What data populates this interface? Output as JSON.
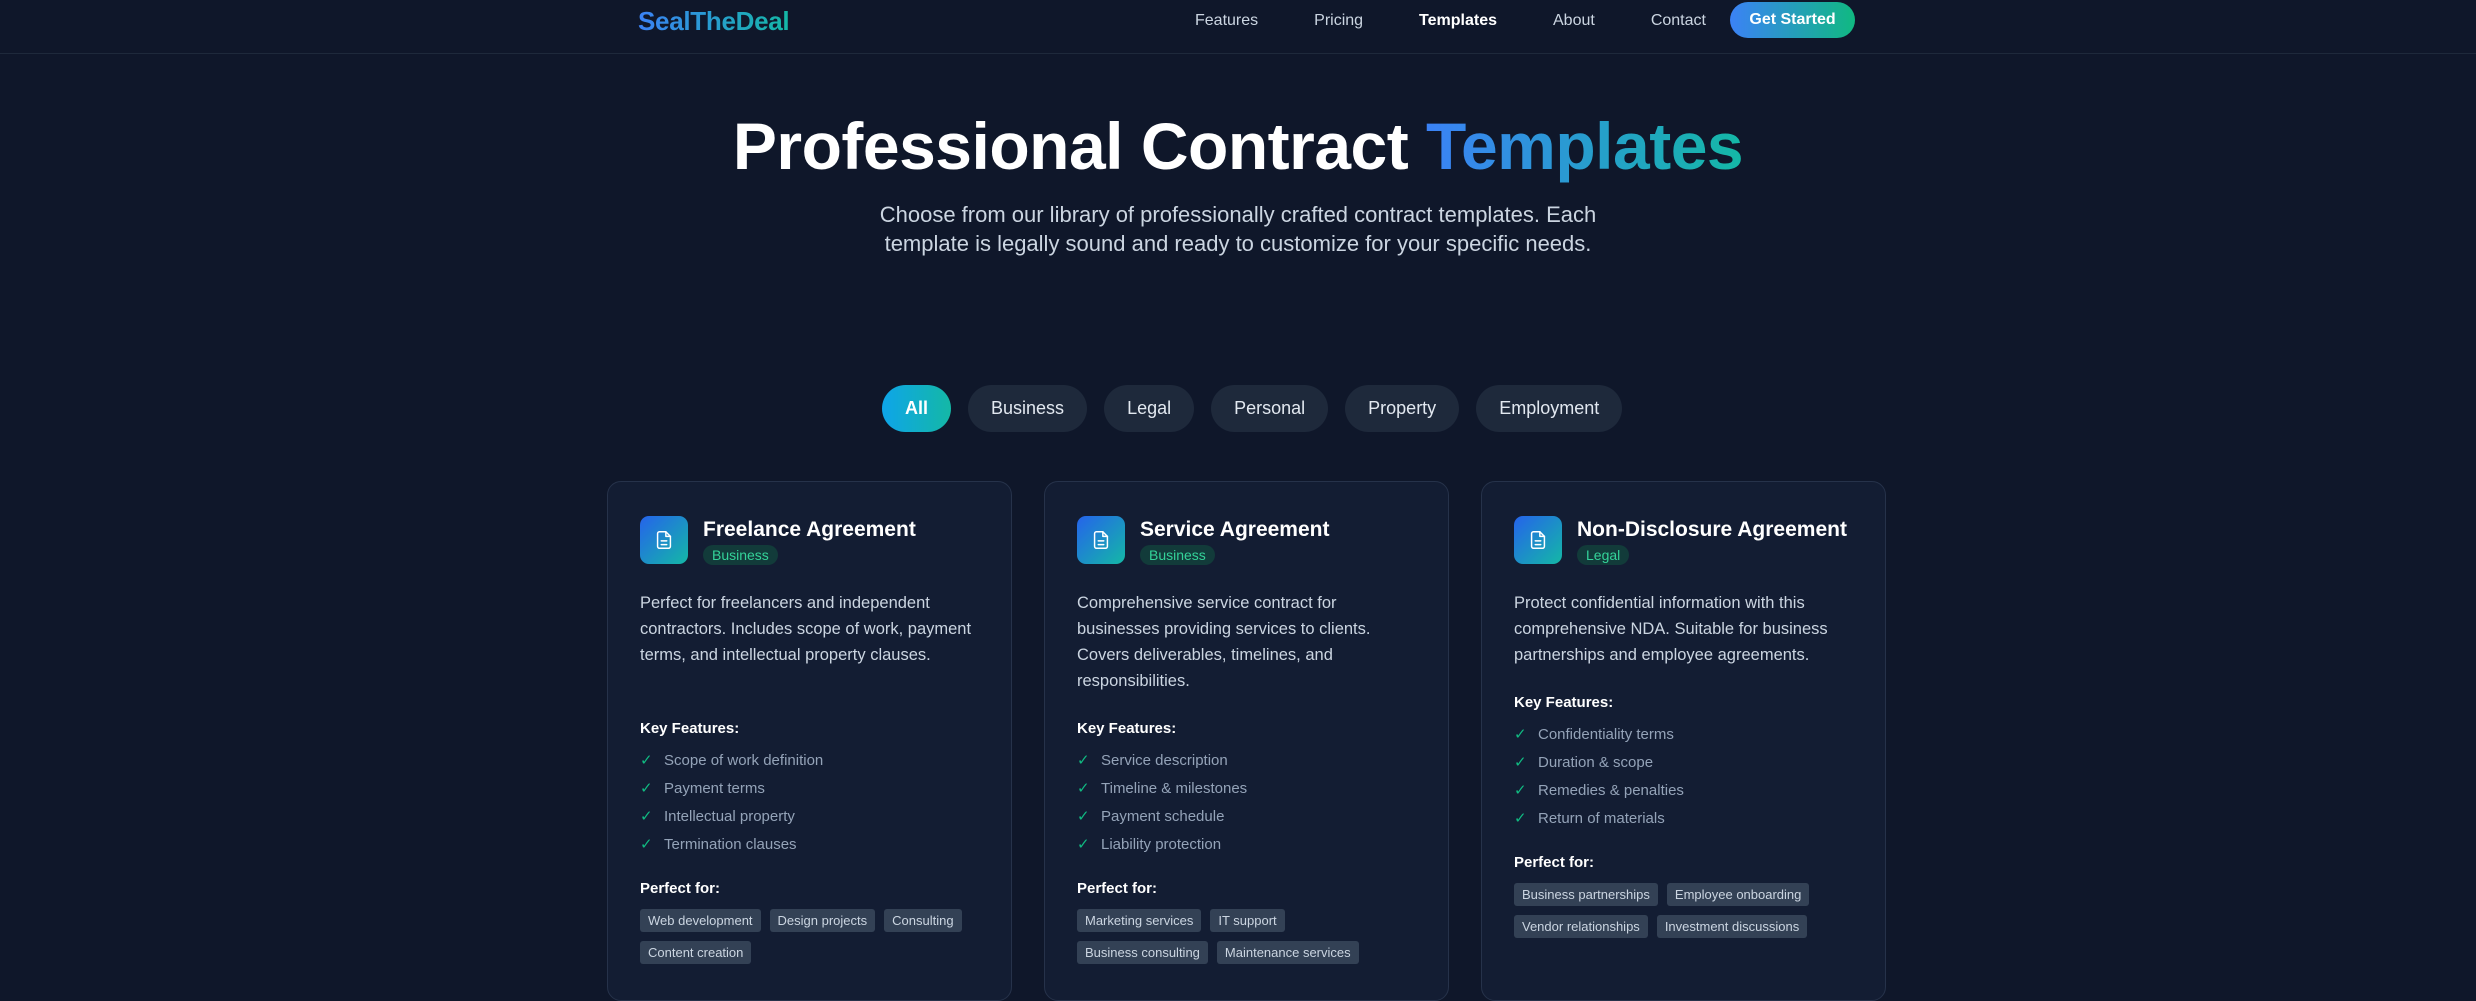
{
  "nav": {
    "brand": "SealTheDeal",
    "links": [
      "Features",
      "Pricing",
      "Templates",
      "About",
      "Contact"
    ],
    "active": "Templates",
    "cta": "Get Started"
  },
  "hero": {
    "title_main": "Professional Contract ",
    "title_highlight": "Templates",
    "subtitle": "Choose from our library of professionally crafted contract templates. Each template is legally sound and ready to customize for your specific needs."
  },
  "filters": {
    "items": [
      "All",
      "Business",
      "Legal",
      "Personal",
      "Property",
      "Employment"
    ],
    "active": "All"
  },
  "labels": {
    "key_features": "Key Features:",
    "perfect_for": "Perfect for:"
  },
  "cards": [
    {
      "title": "Freelance Agreement",
      "category": "Business",
      "description": "Perfect for freelancers and independent contractors. Includes scope of work, payment terms, and intellectual property clauses.",
      "features": [
        "Scope of work definition",
        "Payment terms",
        "Intellectual property",
        "Termination clauses"
      ],
      "tags": [
        "Web development",
        "Design projects",
        "Consulting",
        "Content creation"
      ]
    },
    {
      "title": "Service Agreement",
      "category": "Business",
      "description": "Comprehensive service contract for businesses providing services to clients. Covers deliverables, timelines, and responsibilities.",
      "features": [
        "Service description",
        "Timeline & milestones",
        "Payment schedule",
        "Liability protection"
      ],
      "tags": [
        "Marketing services",
        "IT support",
        "Business consulting",
        "Maintenance services"
      ]
    },
    {
      "title": "Non-Disclosure Agreement",
      "category": "Legal",
      "description": "Protect confidential information with this comprehensive NDA. Suitable for business partnerships and employee agreements.",
      "features": [
        "Confidentiality terms",
        "Duration & scope",
        "Remedies & penalties",
        "Return of materials"
      ],
      "tags": [
        "Business partnerships",
        "Employee onboarding",
        "Vendor relationships",
        "Investment discussions"
      ]
    }
  ],
  "icons": {
    "card": "document-icon",
    "feature": "check-icon"
  },
  "colors": {
    "accent_blue": "#3b82f6",
    "accent_teal": "#14b8a6",
    "check": "#10b981",
    "background": "#0f172a"
  }
}
